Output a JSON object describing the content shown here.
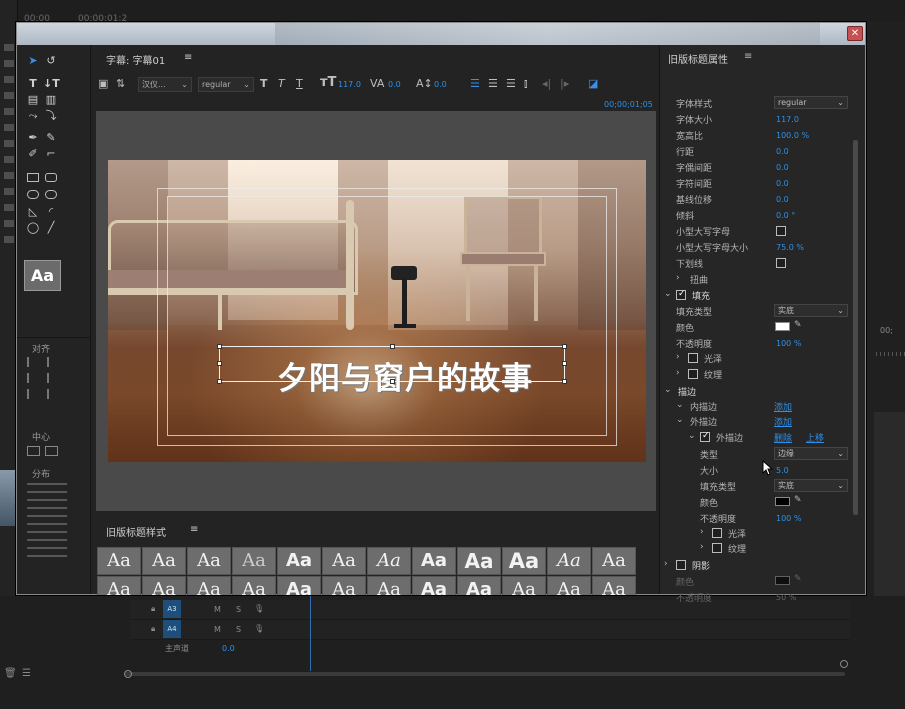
{
  "background": {
    "timecode_left": "00;00",
    "timecode_mid": "00;00;01;2",
    "tracks": [
      {
        "name": "A3",
        "m": "M",
        "s": "S"
      },
      {
        "name": "A4",
        "m": "M",
        "s": "S"
      }
    ],
    "master_label": "主声道",
    "master_value": "0.0",
    "right_value": "00;",
    "right_s": "S"
  },
  "dialog": {
    "editor_tab": "字幕: 字幕01",
    "font_family_dd": "汉仪...",
    "font_style_dd": "regular",
    "font_size": "117.0",
    "kerning": "0.0",
    "leading": "0.0",
    "timecode": "00;00;01;05",
    "title_text": "夕阳与窗户的故事",
    "tools": {
      "aa": "Aa",
      "align_label": "对齐",
      "center_label": "中心",
      "distribute_label": "分布"
    },
    "styles": {
      "header": "旧版标题样式",
      "row1": [
        "Aa",
        "Aa",
        "Aa",
        "Aa",
        "Aa",
        "Aa",
        "Aa",
        "Aa",
        "Aa",
        "Aa",
        "Aa",
        "Aa"
      ],
      "row2": [
        "Aa",
        "Aa",
        "Aa",
        "Aa",
        "Aa",
        "Aa",
        "Aa",
        "Aa",
        "Aa",
        "Aa",
        "Aa",
        "Aa"
      ]
    },
    "props": {
      "header": "旧版标题属性",
      "font_style_label": "字体样式",
      "font_style_value": "regular",
      "font_size_label": "字体大小",
      "font_size_value": "117.0",
      "aspect_label": "宽高比",
      "aspect_value": "100.0 %",
      "leading_label": "行距",
      "leading_value": "0.0",
      "kerning_label": "字偶间距",
      "kerning_value": "0.0",
      "tracking_label": "字符间距",
      "tracking_value": "0.0",
      "baseline_label": "基线位移",
      "baseline_value": "0.0",
      "slant_label": "倾斜",
      "slant_value": "0.0 °",
      "smallcaps_label": "小型大写字母",
      "smallcaps_size_label": "小型大写字母大小",
      "smallcaps_size_value": "75.0 %",
      "underline_label": "下划线",
      "distort_label": "扭曲",
      "fill_label": "填充",
      "fill_type_label": "填充类型",
      "fill_type_value": "实底",
      "color_label": "颜色",
      "opacity_label": "不透明度",
      "opacity_value": "100 %",
      "sheen_label": "光泽",
      "texture_label": "纹理",
      "stroke_label": "描边",
      "inner_stroke_label": "内描边",
      "inner_stroke_add": "添加",
      "outer_stroke_label": "外描边",
      "outer_stroke_add": "添加",
      "outer_stroke_item": "外描边",
      "delete_label": "删除",
      "move_up_label": "上移",
      "type_label": "类型",
      "type_value": "边缘",
      "size_label": "大小",
      "size_value": "5.0",
      "stroke_fill_type_label": "填充类型",
      "stroke_fill_type_value": "实底",
      "stroke_color_label": "颜色",
      "stroke_opacity_label": "不透明度",
      "stroke_opacity_value": "100 %",
      "stroke_sheen_label": "光泽",
      "stroke_texture_label": "纹理",
      "shadow_label": "阴影",
      "shadow_color_label": "颜色",
      "shadow_opacity_label": "不透明度",
      "shadow_opacity_value": "50 %",
      "fill_color": "#ffffff",
      "stroke_color": "#000000",
      "shadow_color": "#000000"
    }
  }
}
